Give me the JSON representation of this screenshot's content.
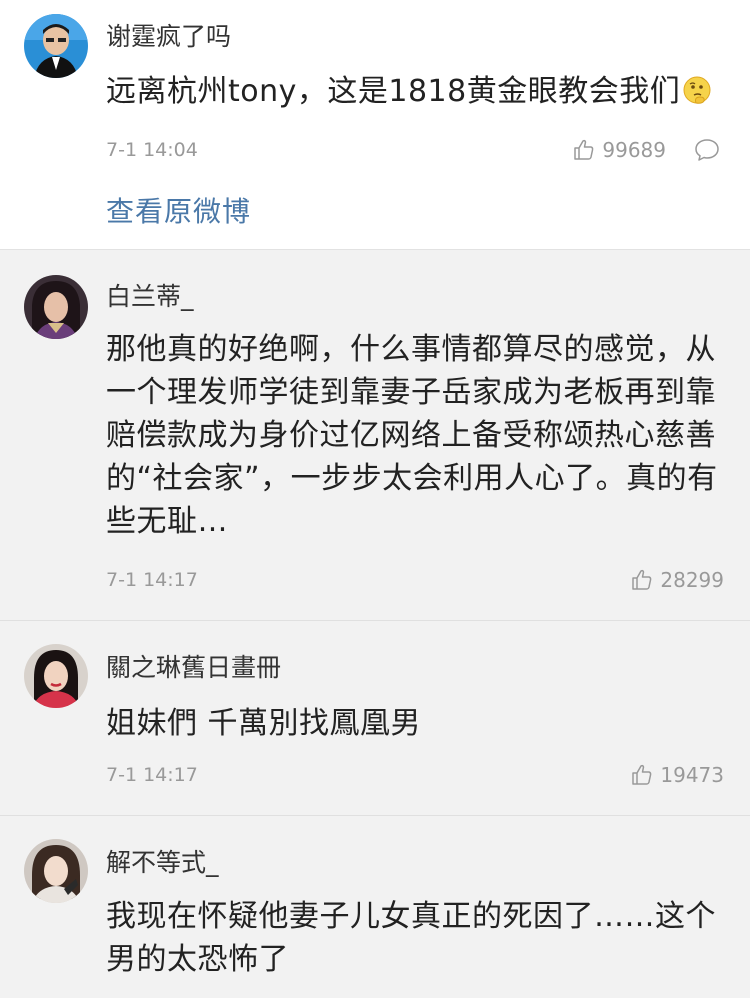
{
  "post": {
    "username": "谢霆疯了吗",
    "text": "远离杭州tony，这是1818黄金眼教会我们",
    "emoji_icon": "thinking-face-icon",
    "time": "7-1 14:04",
    "likes": "99689",
    "view_original": "查看原微博"
  },
  "comments": [
    {
      "username": "白兰蒂_",
      "text": "那他真的好绝啊，什么事情都算尽的感觉，从一个理发师学徒到靠妻子岳家成为老板再到靠赔偿款成为身价过亿网络上备受称颂热心慈善的“社会家”，一步步太会利用人心了。真的有些无耻…",
      "time": "7-1 14:17",
      "likes": "28299"
    },
    {
      "username": "關之琳舊日畫冊",
      "text": "姐妹們 千萬別找鳳凰男",
      "time": "7-1 14:17",
      "likes": "19473"
    },
    {
      "username": "解不等式_",
      "text": "我现在怀疑他妻子儿女真正的死因了……这个男的太恐怖了"
    }
  ],
  "colors": {
    "link": "#4a78a8",
    "meta": "#999999",
    "background": "#f2f2f2"
  }
}
